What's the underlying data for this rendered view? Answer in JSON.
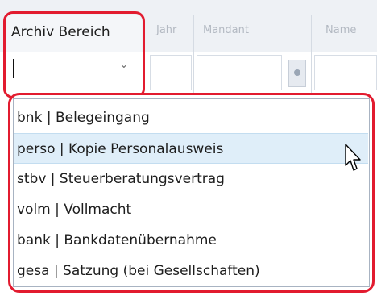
{
  "grid": {
    "columns": [
      {
        "label": "Archiv Bereich",
        "active": true
      },
      {
        "label": "Jahr"
      },
      {
        "label": "Mandant"
      },
      {
        "label": "Name"
      }
    ]
  },
  "filter": {
    "archiv_bereich_value": "",
    "chevron": "chevron-down-icon"
  },
  "dropdown": {
    "items": [
      {
        "label": "bnk | Belegeingang"
      },
      {
        "label": "perso | Kopie Personalausweis",
        "hover": true
      },
      {
        "label": "stbv | Steuerberatungsvertrag"
      },
      {
        "label": "volm | Vollmacht"
      },
      {
        "label": "bank | Bankdatenübernahme"
      },
      {
        "label": "gesa | Satzung (bei Gesellschaften)"
      }
    ]
  },
  "colors": {
    "highlight": "#e21b2f",
    "hover_bg": "#dfeef9"
  }
}
